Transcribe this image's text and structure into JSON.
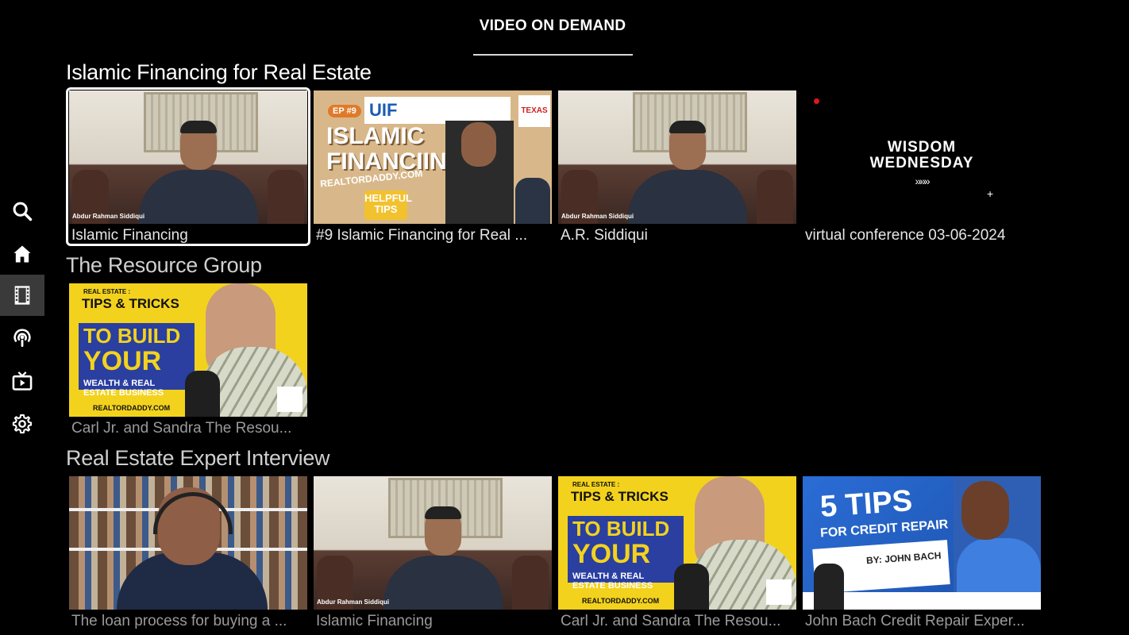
{
  "header": {
    "tab_label": "VIDEO ON DEMAND"
  },
  "sidebar": {
    "items": [
      {
        "name": "search",
        "icon": "search-icon",
        "active": false
      },
      {
        "name": "home",
        "icon": "home-icon",
        "active": false
      },
      {
        "name": "video-on-demand",
        "icon": "film-icon",
        "active": true
      },
      {
        "name": "podcasts",
        "icon": "podcast-icon",
        "active": false
      },
      {
        "name": "live-tv",
        "icon": "tv-icon",
        "active": false
      },
      {
        "name": "settings",
        "icon": "gear-icon",
        "active": false
      }
    ]
  },
  "rows": [
    {
      "title": "Islamic Financing for Real Estate",
      "cards": [
        {
          "title": "Islamic Financing",
          "focused": true,
          "thumb_caption": "Abdur Rahman Siddiqui"
        },
        {
          "title": "#9 Islamic Financing for Real ...",
          "thumb_text": [
            "EP #9",
            "UIF",
            "ISLAMIC",
            "FINANCIING",
            "REALTORDADDY.COM",
            "HELPFUL",
            "TIPS",
            "TEXAS"
          ]
        },
        {
          "title": "A.R. Siddiqui",
          "thumb_caption": "Abdur Rahman Siddiqui"
        },
        {
          "title": "virtual conference 03-06-2024",
          "thumb_text": [
            "WISDOM",
            "WEDNESDAY",
            "»»»",
            "+"
          ]
        }
      ]
    },
    {
      "title": "The Resource Group",
      "cards": [
        {
          "title": "Carl Jr. and Sandra The Resou...",
          "thumb_text": [
            "REAL ESTATE :",
            "TIPS & TRICKS",
            "TO BUILD",
            "YOUR",
            "WEALTH & REAL",
            "ESTATE BUSINESS",
            "REALTORDADDY.COM"
          ]
        }
      ]
    },
    {
      "title": "Real Estate Expert Interview",
      "cards": [
        {
          "title": "The loan process for buying a ..."
        },
        {
          "title": "Islamic Financing",
          "thumb_caption": "Abdur Rahman Siddiqui"
        },
        {
          "title": "Carl Jr. and Sandra The Resou...",
          "thumb_text": [
            "REAL ESTATE :",
            "TIPS & TRICKS",
            "TO BUILD",
            "YOUR",
            "WEALTH & REAL",
            "ESTATE BUSINESS",
            "REALTORDADDY.COM"
          ]
        },
        {
          "title": "John Bach Credit Repair Exper...",
          "thumb_text": [
            "5 TIPS",
            "FOR CREDIT REPAIR",
            "BY: JOHN BACH"
          ]
        }
      ]
    }
  ]
}
